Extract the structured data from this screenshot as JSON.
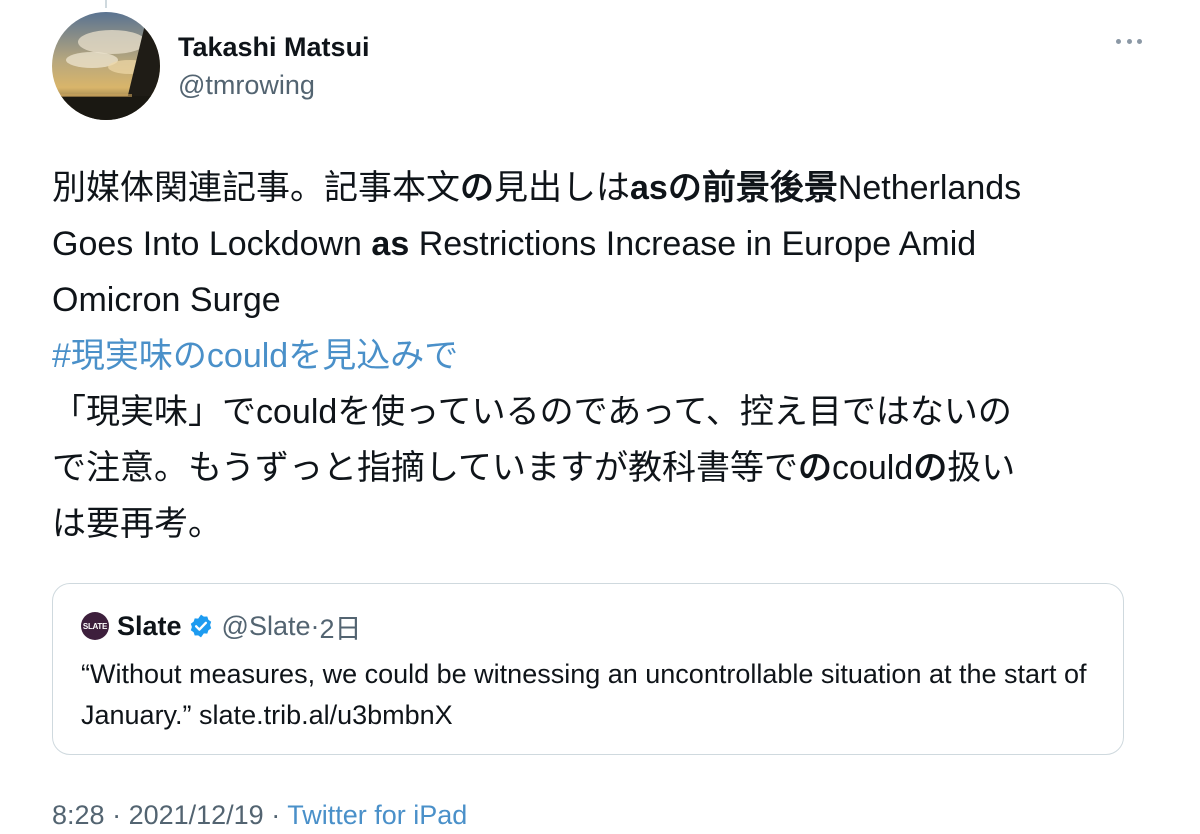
{
  "author": {
    "name": "Takashi Matsui",
    "handle": "@tmrowing"
  },
  "more_icon": "ellipsis-icon",
  "tweet": {
    "line1": [
      {
        "text": "別媒体関連記事。記事本文",
        "bold": false
      },
      {
        "text": "の",
        "bold": true
      },
      {
        "text": "見出しは",
        "bold": false
      },
      {
        "text": "asの前景後景",
        "bold": true
      },
      {
        "text": "Netherlands",
        "bold": false
      }
    ],
    "line2": [
      {
        "text": "Goes Into Lockdown ",
        "bold": false
      },
      {
        "text": "as",
        "bold": true
      },
      {
        "text": " Restrictions Increase in Europe Amid",
        "bold": false
      }
    ],
    "line3": "Omicron Surge",
    "hashtag": "#現実味のcouldを見込みで",
    "line5": "「現実味」でcouldを使っているのであって、控え目ではないの",
    "line6": [
      {
        "text": "で注意。もうずっと指摘していますが教科書等で",
        "bold": false
      },
      {
        "text": "の",
        "bold": true
      },
      {
        "text": "could",
        "bold": false
      },
      {
        "text": "の",
        "bold": true
      },
      {
        "text": "扱い",
        "bold": false
      }
    ],
    "line7": "は要再考。"
  },
  "quote": {
    "logo_text": "SLATE",
    "name": "Slate",
    "handle": "@Slate",
    "separator": "·",
    "time": "2日",
    "text": "“Without measures, we could be witnessing an uncontrollable situation at the start of January.” ",
    "link": "slate.trib.al/u3bmbnX",
    "verified_color": "#1d9bf0"
  },
  "meta": {
    "time": "8:28",
    "sep1": " · ",
    "date": "2021/12/19",
    "sep2": " · ",
    "source": "Twitter for iPad"
  }
}
